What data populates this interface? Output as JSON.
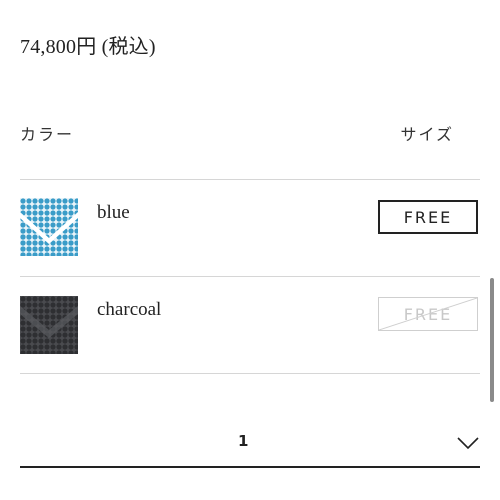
{
  "product": {
    "price": "74,800円 (税込)"
  },
  "table": {
    "color_header": "カラー",
    "size_header": "サイズ",
    "rows": [
      {
        "color": "blue",
        "size": "FREE",
        "available": true,
        "swatch_color": "#3a9cc8"
      },
      {
        "color": "charcoal",
        "size": "FREE",
        "available": false,
        "swatch_color": "#3c3d40"
      }
    ]
  },
  "quantity": {
    "value": "1",
    "icon": "chevron-down-icon"
  },
  "colors": {
    "text": "#222222",
    "divider": "#d6d6d6",
    "disabled": "#c8c8c8"
  }
}
